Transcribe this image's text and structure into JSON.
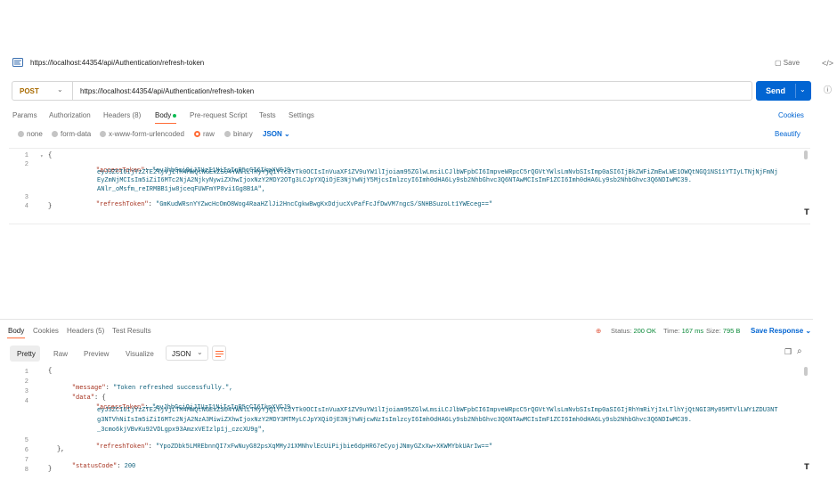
{
  "request": {
    "tab_title": "https://localhost:44354/api/Authentication/refresh-token",
    "save_label": "Save",
    "method": "POST",
    "url": "https://localhost:44354/api/Authentication/refresh-token",
    "send_label": "Send"
  },
  "rail": {
    "code_icon": "</>",
    "info_icon": "ⓘ"
  },
  "req_tabs": {
    "params": "Params",
    "authorization": "Authorization",
    "headers": "Headers (8)",
    "body": "Body",
    "prerequest": "Pre-request Script",
    "tests": "Tests",
    "settings": "Settings",
    "cookies": "Cookies"
  },
  "body_types": {
    "none": "none",
    "form_data": "form-data",
    "urlencoded": "x-www-form-urlencoded",
    "raw": "raw",
    "binary": "binary",
    "json": "JSON",
    "beautify": "Beautify"
  },
  "request_body": {
    "line_numbers": [
      "1",
      "2",
      "3",
      "4"
    ],
    "open_brace": "{",
    "close_brace": "}",
    "access_key": "\"accessToken\"",
    "access_lines": [
      "\"eyJhbGciOiJIUzI1NiIsInR5cCI6IkpXVCJ9.",
      "eyJ3ZCI6IjYzZTE2YjVjLTM4MWQtNGExZS04YWNlLTMyYjQ1YTc2YTk0OCIsInVuaXF1ZV9uYW1lIjoiam95ZGlwLmsiLCJlbWFpbCI6ImpveWRpcC5rQGVtYWlsLmNvbSIsImp0aSI6IjBkZWFiZmEwLWE1OWQtNGQ1NS11YTIyLTNjNjFmNj",
      "EyZmNjMCIsIm5iZiI6MTc2NjA2NjkyNywiZXhwIjoxNzY2MDY2OTg3LCJpYXQiOjE3NjYwNjY5MjcsImlzcyI6Imh0dHA6Ly9sb2NhbGhvc3Q6NTAwMCIsImF1ZCI6Imh0dHA6Ly9sb2NhbGhvc3Q6NDIwMC39.",
      "ANlr_oMsfm_reIRMBB1jw8jceqFUWFmYP8vi1Gg8B1A\","
    ],
    "refresh_key": "\"refreshToken\"",
    "refresh_value": "\"GmKudWRsnYYZwcHcOmO8Wog4RaaHZlJi2HncCgkwBwgKxDdjucXvPafFcJfDwVM7ngcS/SNHBSuzoLt1YWEceg==\""
  },
  "response": {
    "tabs": {
      "body": "Body",
      "cookies": "Cookies",
      "headers": "Headers (5)",
      "results": "Test Results"
    },
    "status_label": "Status:",
    "status_value": "200 OK",
    "time_label": "Time:",
    "time_value": "167 ms",
    "size_label": "Size:",
    "size_value": "795 B",
    "save_response": "Save Response",
    "views": {
      "pretty": "Pretty",
      "raw": "Raw",
      "preview": "Preview",
      "visualize": "Visualize",
      "format": "JSON"
    },
    "line_numbers": [
      "1",
      "2",
      "3",
      "4",
      "5",
      "6",
      "7",
      "8"
    ],
    "open_brace": "{",
    "message_key": "\"message\"",
    "message_value": "\"Token refreshed successfully.\",",
    "data_key": "\"data\"",
    "data_open": "{",
    "access_key": "\"accessToken\"",
    "access_lines": [
      "\"eyJhbGciOiJIUzI1NiIsInR5cCI6IkpXVCJ9.",
      "eyJ3ZCI6IjYzZTE2YjVjLTM4MWQtNGExZS04YWNlLTMyYjQ1YTc2YTk0OCIsInVuaXF1ZV9uYW1lIjoiam95ZGlwLmsiLCJlbWFpbCI6ImpveWRpcC5rQGVtYWlsLmNvbSIsImp0aSI6IjRhYmRiYjIxLTlhYjQtNGI3My05MTVlLWY1ZDU3NT",
      "g3NTVhNiIsIm5iZiI6MTc2NjA2NzA3MiwiZXhwIjoxNzY2MDY3MTMyLCJpYXQiOjE3NjYwNjcwNzIsImlzcyI6Imh0dHA6Ly9sb2NhbGhvc3Q6NTAwMCIsImF1ZCI6Imh0dHA6Ly9sb2NhbGhvc3Q6NDIwMC39.",
      "_3cmo6kjVBvKu92VDLgpx93AmzxVEIzlp1j_czcXU9g\","
    ],
    "refresh_key": "\"refreshToken\"",
    "refresh_value": "\"YpoZDbk5LMREbnnQI7xFwNuyG82psXqMMyJ1XMNhvlEcUiPijbie6dpHR67eCyojJNmyGZxXw+XKWMYbkUArIw==\"",
    "data_close": "},",
    "status_code_key": "\"statusCode\"",
    "status_code_value": "200",
    "close_brace": "}"
  }
}
